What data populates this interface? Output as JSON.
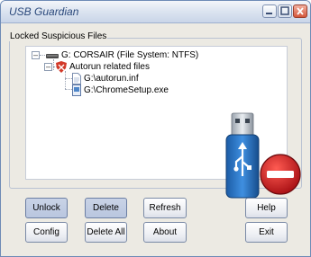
{
  "window": {
    "title": "USB Guardian"
  },
  "titlebar_buttons": {
    "minimize_icon": "minimize-icon",
    "maximize_icon": "maximize-icon",
    "close_icon": "close-icon"
  },
  "group": {
    "label": "Locked Suspicious Files"
  },
  "tree": {
    "root_label": "G: CORSAIR (File System: NTFS)",
    "child_label": "Autorun related files",
    "files": [
      "G:\\autorun.inf",
      "G:\\ChromeSetup.exe"
    ]
  },
  "buttons": {
    "unlock": "Unlock",
    "delete": "Delete",
    "refresh": "Refresh",
    "help": "Help",
    "config": "Config",
    "delete_all": "Delete All",
    "about": "About",
    "exit": "Exit"
  },
  "colors": {
    "accent": "#2c4a7c",
    "usb_blue": "#1f6fb8",
    "stop_red": "#c8121a"
  }
}
